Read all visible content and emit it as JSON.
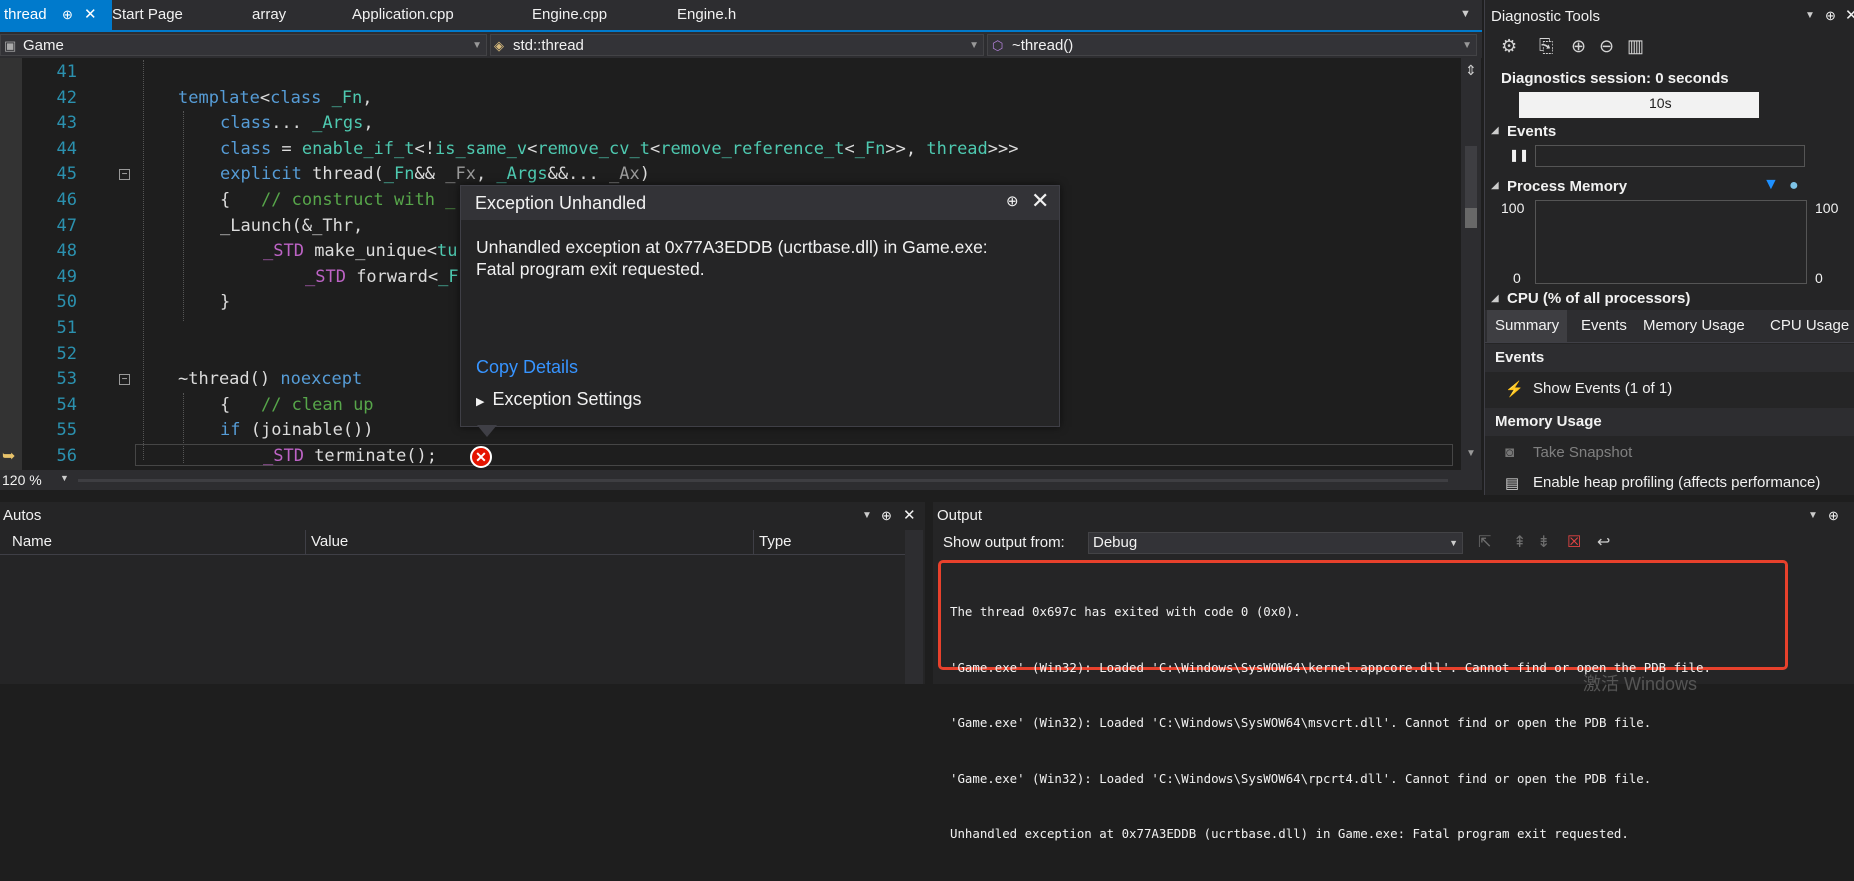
{
  "tabs": {
    "active": "thread",
    "items": [
      "Start Page",
      "array",
      "Application.cpp",
      "Engine.cpp",
      "Engine.h"
    ]
  },
  "navbar": {
    "project": "Game",
    "scope": "std::thread",
    "member": "~thread()"
  },
  "editor": {
    "line_numbers": [
      "41",
      "42",
      "43",
      "44",
      "45",
      "46",
      "47",
      "48",
      "49",
      "50",
      "51",
      "52",
      "53",
      "54",
      "55",
      "56"
    ],
    "zoom": "120 %"
  },
  "dialog": {
    "title": "Exception Unhandled",
    "message_line1": "Unhandled exception at 0x77A3EDDB (ucrtbase.dll) in Game.exe:",
    "message_line2": "Fatal program exit requested.",
    "copy_details": "Copy Details",
    "exception_settings": "Exception Settings"
  },
  "autos": {
    "title": "Autos",
    "columns": [
      "Name",
      "Value",
      "Type"
    ]
  },
  "output": {
    "title": "Output",
    "show_from_label": "Show output from:",
    "source": "Debug",
    "lines": [
      "The thread 0x697c has exited with code 0 (0x0).",
      "'Game.exe' (Win32): Loaded 'C:\\Windows\\SysWOW64\\kernel.appcore.dll'. Cannot find or open the PDB file.",
      "'Game.exe' (Win32): Loaded 'C:\\Windows\\SysWOW64\\msvcrt.dll'. Cannot find or open the PDB file.",
      "'Game.exe' (Win32): Loaded 'C:\\Windows\\SysWOW64\\rpcrt4.dll'. Cannot find or open the PDB file.",
      "Unhandled exception at 0x77A3EDDB (ucrtbase.dll) in Game.exe: Fatal program exit requested."
    ],
    "highlight_color": "#e8412c"
  },
  "diag": {
    "title": "Diagnostic Tools",
    "session": "Diagnostics session: 0 seconds",
    "timeline_label": "10s",
    "events": "Events",
    "process_memory": "Process Memory",
    "mem_max_left": "100",
    "mem_min_left": "0",
    "mem_max_right": "100",
    "mem_min_right": "0",
    "cpu": "CPU (% of all processors)",
    "subtabs": [
      "Summary",
      "Events",
      "Memory Usage",
      "CPU Usage"
    ],
    "events_header": "Events",
    "show_events": "Show Events (1 of 1)",
    "memory_usage_header": "Memory Usage",
    "take_snapshot": "Take Snapshot",
    "enable_heap": "Enable heap profiling (affects performance)"
  },
  "watermark": "激活 Windows",
  "colors": {
    "accent": "#007acc",
    "error": "#e51400"
  }
}
